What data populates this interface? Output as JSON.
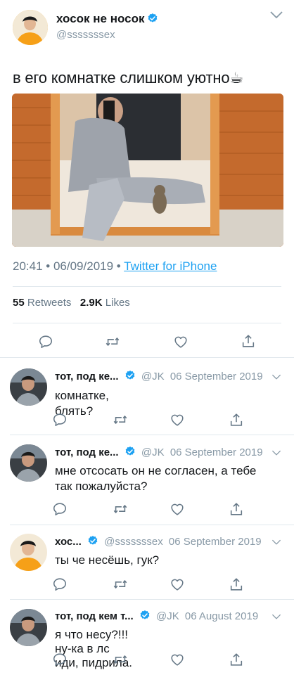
{
  "main_tweet": {
    "display_name": "хосок не носок",
    "handle": "@sssssssex",
    "text": "в его комнатке слишком уютно☕",
    "time": "20:41",
    "date": "06/09/2019",
    "separator": "•",
    "source": "Twitter for iPhone",
    "retweets_count": "55",
    "retweets_label": "Retweets",
    "likes_count": "2.9K",
    "likes_label": "Likes"
  },
  "replies": [
    {
      "display_name": "тот, под ке...",
      "handle": "@JK",
      "date": "06 September 2019",
      "lines": [
        "комнатке,",
        "блять?"
      ]
    },
    {
      "display_name": "тот, под ке...",
      "handle": "@JK",
      "date": "06 September 2019",
      "lines": [
        "мне отсосать он не согласен, а тебе",
        "так пожалуйста?"
      ]
    },
    {
      "display_name": "хос...",
      "handle": "@sssssssex",
      "date": "06 September 2019",
      "lines": [
        "ты че несёшь, гук?"
      ]
    },
    {
      "display_name": "тот, под кем т...",
      "handle": "@JK",
      "date": "06 August 2019",
      "lines": [
        "я что несу?!!!",
        "ну-ка в лс",
        "иди, пидрила."
      ]
    }
  ],
  "colors": {
    "link": "#1da1f2",
    "muted": "#657786",
    "handle": "#8899a6",
    "text": "#14171a",
    "divider": "#e1e8ed",
    "verified": "#1da1f2"
  },
  "icons": [
    "verified-badge-icon",
    "chevron-down-icon",
    "reply-icon",
    "retweet-icon",
    "like-icon",
    "share-icon"
  ]
}
